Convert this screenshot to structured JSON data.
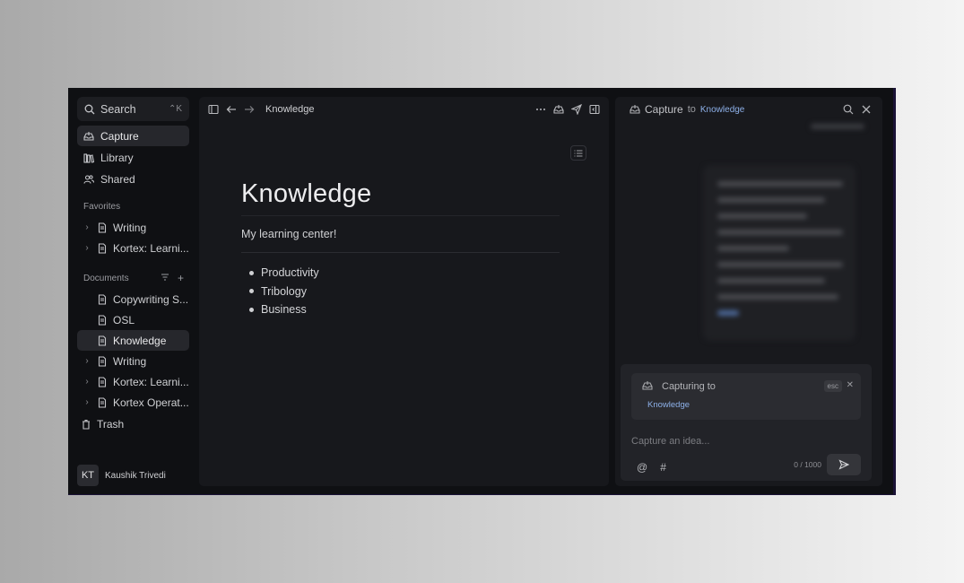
{
  "sidebar": {
    "search_label": "Search",
    "search_shortcut": "⌃K",
    "nav": [
      {
        "label": "Capture",
        "icon": "inbox-tray-icon",
        "active": true
      },
      {
        "label": "Library",
        "icon": "library-icon",
        "active": false
      },
      {
        "label": "Shared",
        "icon": "users-icon",
        "active": false
      }
    ],
    "favorites_label": "Favorites",
    "favorites": [
      {
        "label": "Writing"
      },
      {
        "label": "Kortex: Learni..."
      }
    ],
    "documents_label": "Documents",
    "documents": [
      {
        "label": "Copywriting S...",
        "expandable": false,
        "active": false
      },
      {
        "label": "OSL",
        "expandable": false,
        "active": false
      },
      {
        "label": "Knowledge",
        "expandable": false,
        "active": true
      },
      {
        "label": "Writing",
        "expandable": true,
        "active": false
      },
      {
        "label": "Kortex: Learni...",
        "expandable": true,
        "active": false
      },
      {
        "label": "Kortex Operat...",
        "expandable": true,
        "active": false
      }
    ],
    "trash_label": "Trash",
    "user": {
      "initials": "KT",
      "name": "Kaushik Trivedi"
    }
  },
  "main": {
    "breadcrumb": "Knowledge",
    "title": "Knowledge",
    "subtitle": "My learning center!",
    "bullets": [
      "Productivity",
      "Tribology",
      "Business"
    ]
  },
  "capture": {
    "title": "Capture",
    "to": "to",
    "destination": "Knowledge",
    "capturing_label": "Capturing to",
    "esc_label": "esc",
    "chip": "Knowledge",
    "input_placeholder": "Capture an idea...",
    "mention_symbol": "@",
    "tag_symbol": "#",
    "count": "0 / 1000"
  },
  "colors": {
    "background": "#0f1013",
    "panel": "#17181c",
    "accent_link": "#8db0e8",
    "frame_border": "#1a1236"
  }
}
